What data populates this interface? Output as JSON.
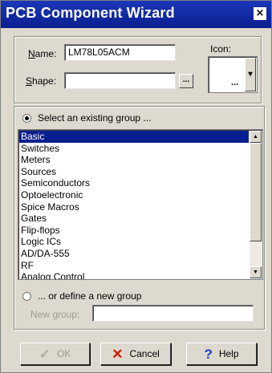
{
  "window": {
    "title": "PCB Component Wizard",
    "close_glyph": "×"
  },
  "form": {
    "name_label": "Name:",
    "name_value": "LM78L05ACM",
    "shape_label": "Shape:",
    "shape_value": "",
    "shape_browse": "...",
    "icon_label": "Icon:",
    "icon_browse": "...",
    "icon_dropdown": "▾"
  },
  "group": {
    "existing_label": "Select an existing group ...",
    "items": [
      "Basic",
      "Switches",
      "Meters",
      "Sources",
      "Semiconductors",
      "Optoelectronic",
      "Spice Macros",
      "Gates",
      "Flip-flops",
      "Logic ICs",
      "AD/DA-555",
      "RF",
      "Analog Control"
    ],
    "selected_index": 0,
    "new_label": "... or define a new group",
    "new_group_label": "New group:",
    "new_group_value": ""
  },
  "buttons": {
    "ok": "OK",
    "cancel": "Cancel",
    "help": "Help"
  },
  "icons": {
    "ok": "check-icon",
    "cancel": "x-icon",
    "help": "question-icon"
  },
  "colors": {
    "title_bar": "#0a1f8f",
    "cancel_x": "#d21a00",
    "help_q": "#1a3fbf"
  }
}
